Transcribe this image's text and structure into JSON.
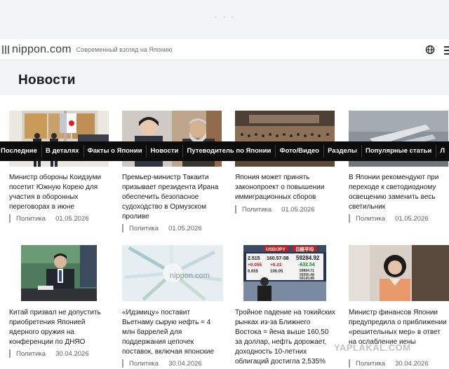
{
  "header": {
    "logo_text": "nippon.com",
    "tagline": "Современный взгляд на Японию",
    "globe_icon": "globe-icon"
  },
  "page_title": "Новости",
  "nav": [
    "Последние",
    "В деталях",
    "Факты о Японии",
    "Новости",
    "Путеводитель по Японии",
    "Фото/Видео",
    "Разделы",
    "Популярные статьи",
    "Л"
  ],
  "articles": [
    {
      "title": "Министр обороны Коидзуми посетит Южную Корею для участия в оборонных переговорах в июне",
      "category": "Политика",
      "date": "01.05.2026"
    },
    {
      "title": "Премьер-министр Такаити призывает президента Ирана обеспечить безопасное судоходство в Ормузском проливе",
      "category": "Политика",
      "date": "01.05.2026"
    },
    {
      "title": "Япония может принять законопроект о повышении иммиграционных сборов",
      "category": "Политика",
      "date": "01.05.2026"
    },
    {
      "title": "В Японии рекомендуют при переходе к светодиодному освещению заменить весь светильник",
      "category": "Политика",
      "date": "01.05.2026"
    },
    {
      "title": "Китай призвал не допустить приобретения Японией ядерного оружия на конференции по ДНЯО",
      "category": "Политика",
      "date": "30.04.2026"
    },
    {
      "title": "«Идэмицу» поставит Вьетнаму сырую нефть = 4 млн баррелей для поддержания цепочек поставок, включая японские",
      "category": "Политика",
      "date": "30.04.2026"
    },
    {
      "title": "Тройное падение на токийских рынках из-за Ближнего Востока = йена выше 160,50 за доллар, нефть дорожает, доходность 10-летних облигаций достигла 2,535%",
      "category": "Политика",
      "date": "30.04.2026"
    },
    {
      "title": "Министр финансов Японии предупредила о приближении «решительных мер» в ответ на ослабление иены",
      "category": "Политика",
      "date": "30.04.2026"
    }
  ],
  "thumb3_board": {
    "headers": [
      "USD/JPY",
      "日経平均"
    ],
    "left": [
      "2.515",
      "+0.055",
      "6.655"
    ],
    "mid": [
      "160.57-58",
      "+0.23",
      "106.05"
    ],
    "right": [
      "59284.92",
      "-632.54",
      "59864.71",
      "59300.48",
      "59120.88"
    ]
  },
  "thumb1_watermark": "nippon.com",
  "watermark": "YAPLAKAL.COM",
  "colors": {
    "nav_bg": "#0c0c0c",
    "accent_red": "#e02020",
    "page_bg": "#f2f4f5"
  }
}
